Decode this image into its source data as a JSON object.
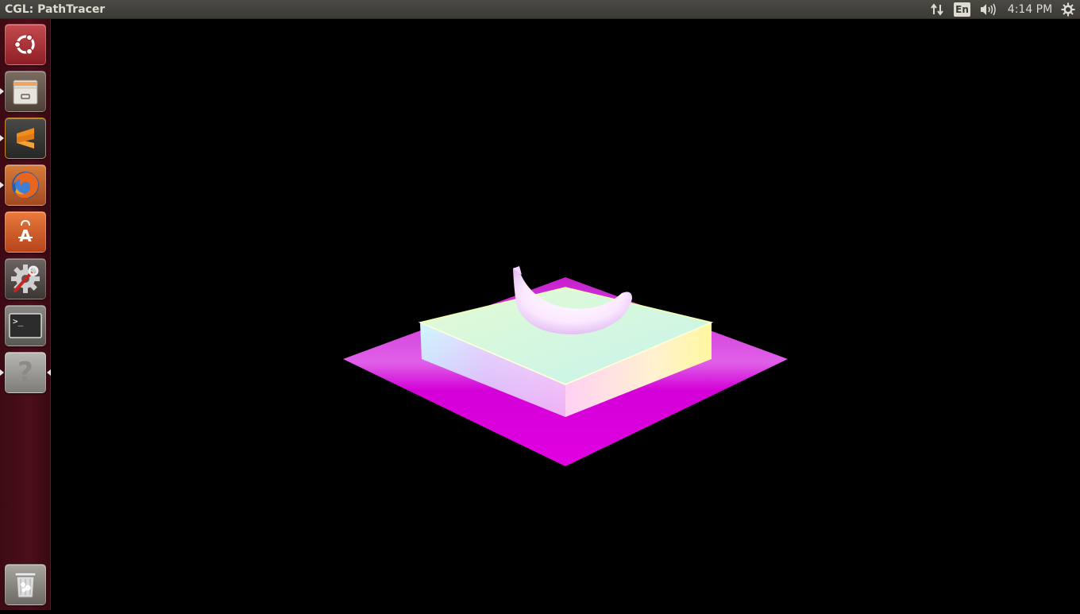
{
  "window": {
    "title": "CGL: PathTracer"
  },
  "indicators": {
    "network_icon": "network-updown-icon",
    "keyboard_layout": "En",
    "sound_icon": "speaker-volume-icon",
    "clock": "4:14 PM",
    "session_icon": "power-gear-icon"
  },
  "launcher": {
    "items": [
      {
        "name": "ubuntu-dash",
        "icon": "ubuntu-logo-icon"
      },
      {
        "name": "files",
        "icon": "file-cabinet-icon"
      },
      {
        "name": "sublime-text",
        "icon": "sublime-s-icon"
      },
      {
        "name": "firefox",
        "icon": "firefox-icon"
      },
      {
        "name": "ubuntu-software",
        "icon": "shopping-bag-icon"
      },
      {
        "name": "system-settings",
        "icon": "gear-wrench-icon"
      },
      {
        "name": "terminal",
        "icon": "terminal-icon",
        "prompt": ">_"
      },
      {
        "name": "help",
        "icon": "question-mark-icon",
        "glyph": "?"
      },
      {
        "name": "trash",
        "icon": "trash-icon"
      }
    ]
  },
  "scene": {
    "description_color_floor": "#e000e0",
    "accent_colors": [
      "#ff00ff",
      "#bfffe0",
      "#f0b0ff",
      "#ffffff"
    ]
  }
}
